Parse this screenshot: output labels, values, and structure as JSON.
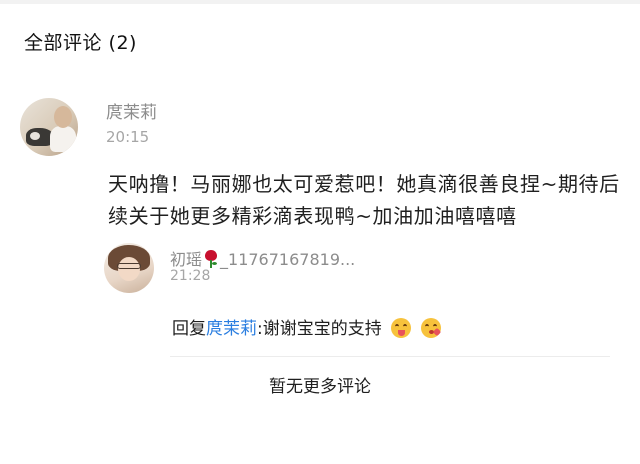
{
  "header": {
    "title": "全部评论 (2)"
  },
  "comment": {
    "username": "庹茉莉",
    "time": "20:15",
    "avatar_icon": "user-avatar-child-with-dog",
    "text": "天呐撸！马丽娜也太可爱惹吧！她真滴很善良捏~期待后续关于她更多精彩滴表现鸭~加油加油嘻嘻嘻"
  },
  "reply": {
    "username_prefix": "初瑶",
    "rose_icon": "rose-icon",
    "username_suffix": "_11767167819...",
    "time": "21:28",
    "avatar_icon": "user-avatar-girl-with-glasses",
    "reply_prefix": "回复",
    "reply_to": "庹茉莉",
    "reply_body": ":谢谢宝宝的支持",
    "emojis": [
      "tongue-out-emoji",
      "kiss-emoji"
    ]
  },
  "footer": {
    "no_more": "暂无更多评论"
  },
  "colors": {
    "link": "#2a7ee0",
    "meta": "#a6a6a6",
    "username": "#8c8c8c"
  }
}
